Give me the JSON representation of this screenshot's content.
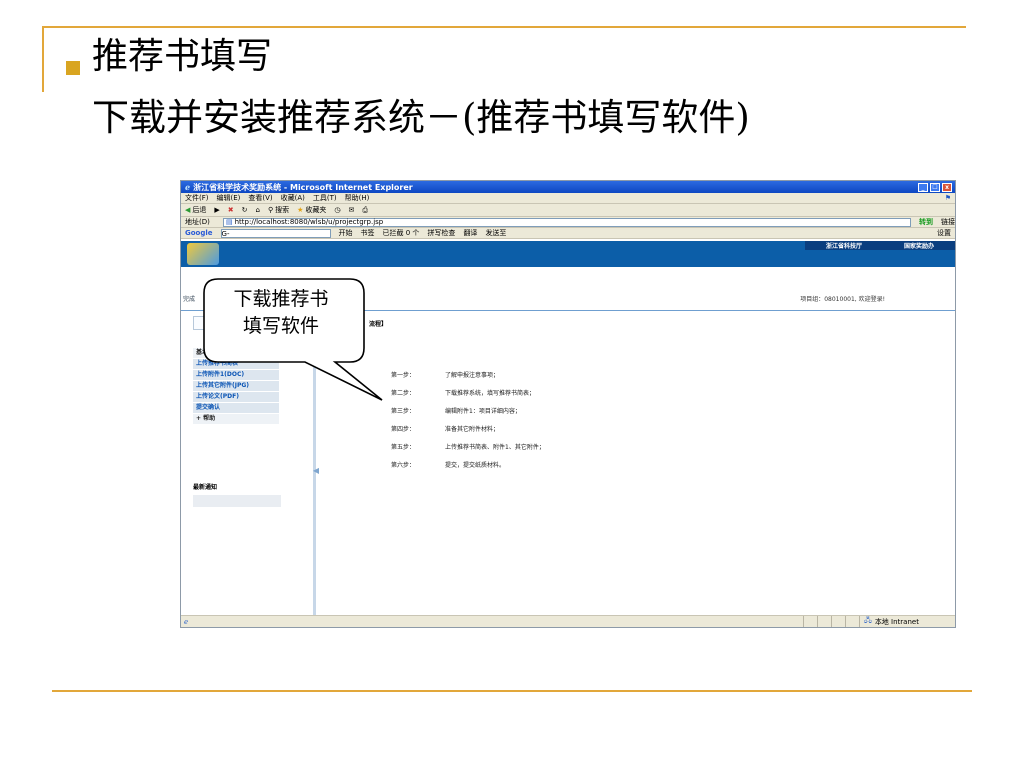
{
  "slide": {
    "heading": "推荐书填写",
    "subheading": "下载并安装推荐系统－(推荐书填写软件)",
    "callout": [
      "下载推荐书",
      "填写软件"
    ]
  },
  "browser": {
    "title": "浙江省科学技术奖励系统 - Microsoft Internet Explorer",
    "window_buttons": [
      "_",
      "☐",
      "x"
    ],
    "menu": [
      "文件(F)",
      "编辑(E)",
      "查看(V)",
      "收藏(A)",
      "工具(T)",
      "帮助(H)"
    ],
    "toolbar": {
      "back": "后退",
      "search": "搜索",
      "favorites": "收藏夹"
    },
    "address": {
      "label": "地址(D)",
      "url": "http://localhost:8080/wlsb/u/projectgrp.jsp",
      "go": "转到",
      "links": "链接"
    },
    "google_bar": {
      "brand": "Google",
      "input_prefix": "G-",
      "items": [
        "开始",
        "书签",
        "已拦截 0 个",
        "拼写检查",
        "翻译",
        "发送至"
      ],
      "settings": "设置"
    },
    "status": {
      "zone": "本地 Intranet"
    }
  },
  "site": {
    "header_links": [
      "浙江省科技厅",
      "国家奖励办"
    ],
    "breadcrumb_left": "完成",
    "welcome": "项目组：08010001, 欢迎登录!",
    "content_title": "流程】",
    "sidebar_items": [
      "基本信息",
      "上传推荐书简表",
      "上传附件1(DOC)",
      "上传其它附件(JPG)",
      "上传论文(PDF)",
      "提交确认",
      "+ 帮助"
    ],
    "notice_label": "最新通知",
    "steps": [
      {
        "num": "第一步：",
        "text": "了解申报注意事项；"
      },
      {
        "num": "第二步：",
        "text": "下载推荐系统，填写推荐书简表；"
      },
      {
        "num": "第三步：",
        "text": "编辑附件1：项目详细内容；"
      },
      {
        "num": "第四步：",
        "text": "准备其它附件材料；"
      },
      {
        "num": "第五步：",
        "text": "上传推荐书简表、附件1、其它附件；"
      },
      {
        "num": "第六步：",
        "text": "提交，提交纸质材料。"
      }
    ]
  },
  "colors": {
    "accent_gold": "#e2a73a",
    "bullet": "#d9a521",
    "xp_blue": "#0d47c2",
    "site_blue": "#0c5ea8"
  }
}
